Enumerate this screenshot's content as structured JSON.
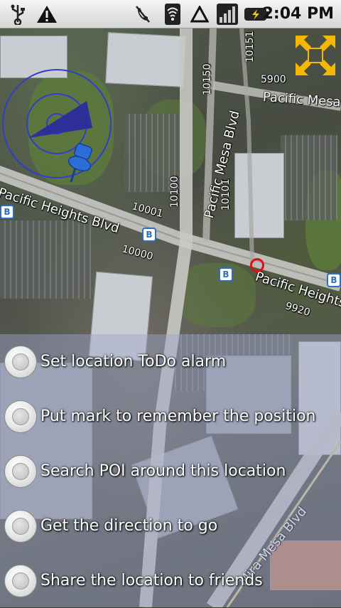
{
  "status_bar": {
    "time": "2:04 PM",
    "icons": [
      "usb-icon",
      "warning-icon",
      "mute-icon",
      "wifi-icon",
      "triangle-icon",
      "signal-icon",
      "battery-charging-icon"
    ]
  },
  "map": {
    "road_labels": {
      "pacific_mesa_top": "Pacific Mesa",
      "pacific_mesa_blvd": "Pacific Mesa Blvd",
      "pacific_heights_left": "Pacific Heights Blvd",
      "pacific_heights_right": "Pacific Heights B",
      "mira_mesa_blvd": "Mira Mesa Blvd"
    },
    "address_labels": {
      "a10150": "10150",
      "a10151": "10151",
      "a5900": "5900",
      "a10100": "10100",
      "a10101": "10101",
      "a10001": "10001",
      "a10000": "10000",
      "a9920": "9920"
    },
    "transit_glyph": "B",
    "colors": {
      "compass": "#2f3fc8",
      "marker": "#e01010",
      "fullscreen": "#f5b800"
    }
  },
  "menu": {
    "items": [
      {
        "label": "Set location ToDo alarm"
      },
      {
        "label": "Put mark to remember the position"
      },
      {
        "label": "Search POI around this location"
      },
      {
        "label": "Get the direction to go"
      },
      {
        "label": "Share the location to friends"
      }
    ]
  }
}
